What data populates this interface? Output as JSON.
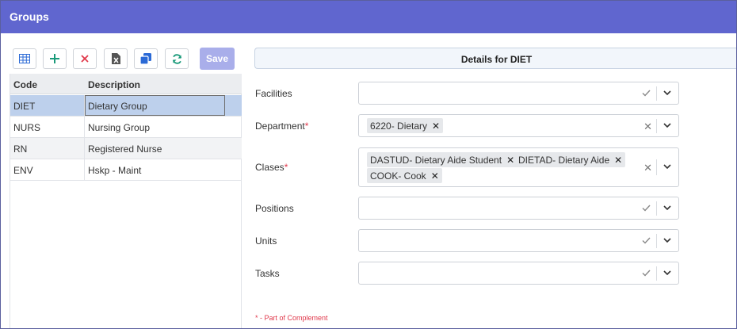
{
  "header": {
    "title": "Groups"
  },
  "toolbar": {
    "save_label": "Save",
    "icons": [
      "grid-view-icon",
      "add-icon",
      "delete-icon",
      "excel-export-icon",
      "copy-icon",
      "refresh-icon"
    ],
    "colors": {
      "add": "#1a9a7a",
      "delete": "#e0384b",
      "copy": "#2b6ad6",
      "refresh": "#1a9a7a",
      "save_disabled": "#a9aeea"
    }
  },
  "grid": {
    "columns": [
      "Code",
      "Description"
    ],
    "rows": [
      {
        "code": "DIET",
        "description": "Dietary Group",
        "selected": true
      },
      {
        "code": "NURS",
        "description": "Nursing Group",
        "selected": false
      },
      {
        "code": "RN",
        "description": "Registered Nurse",
        "selected": false
      },
      {
        "code": "ENV",
        "description": "Hskp - Maint",
        "selected": false
      }
    ]
  },
  "details": {
    "title": "Details for DIET",
    "fields": {
      "facilities": {
        "label": "Facilities",
        "required": false,
        "values": []
      },
      "department": {
        "label": "Department",
        "required": true,
        "values": [
          "6220- Dietary"
        ]
      },
      "clases": {
        "label": "Clases",
        "required": true,
        "values": [
          "DASTUD- Dietary Aide Student",
          "DIETAD- Dietary Aide",
          "COOK- Cook"
        ]
      },
      "positions": {
        "label": "Positions",
        "required": false,
        "values": []
      },
      "units": {
        "label": "Units",
        "required": false,
        "values": []
      },
      "tasks": {
        "label": "Tasks",
        "required": false,
        "values": []
      }
    },
    "required_mark": "*",
    "footnote": "* - Part of Complement"
  },
  "theme": {
    "header_bg": "#6066cf",
    "selected_row": "#bdd0ec",
    "required_color": "#e0384b"
  }
}
